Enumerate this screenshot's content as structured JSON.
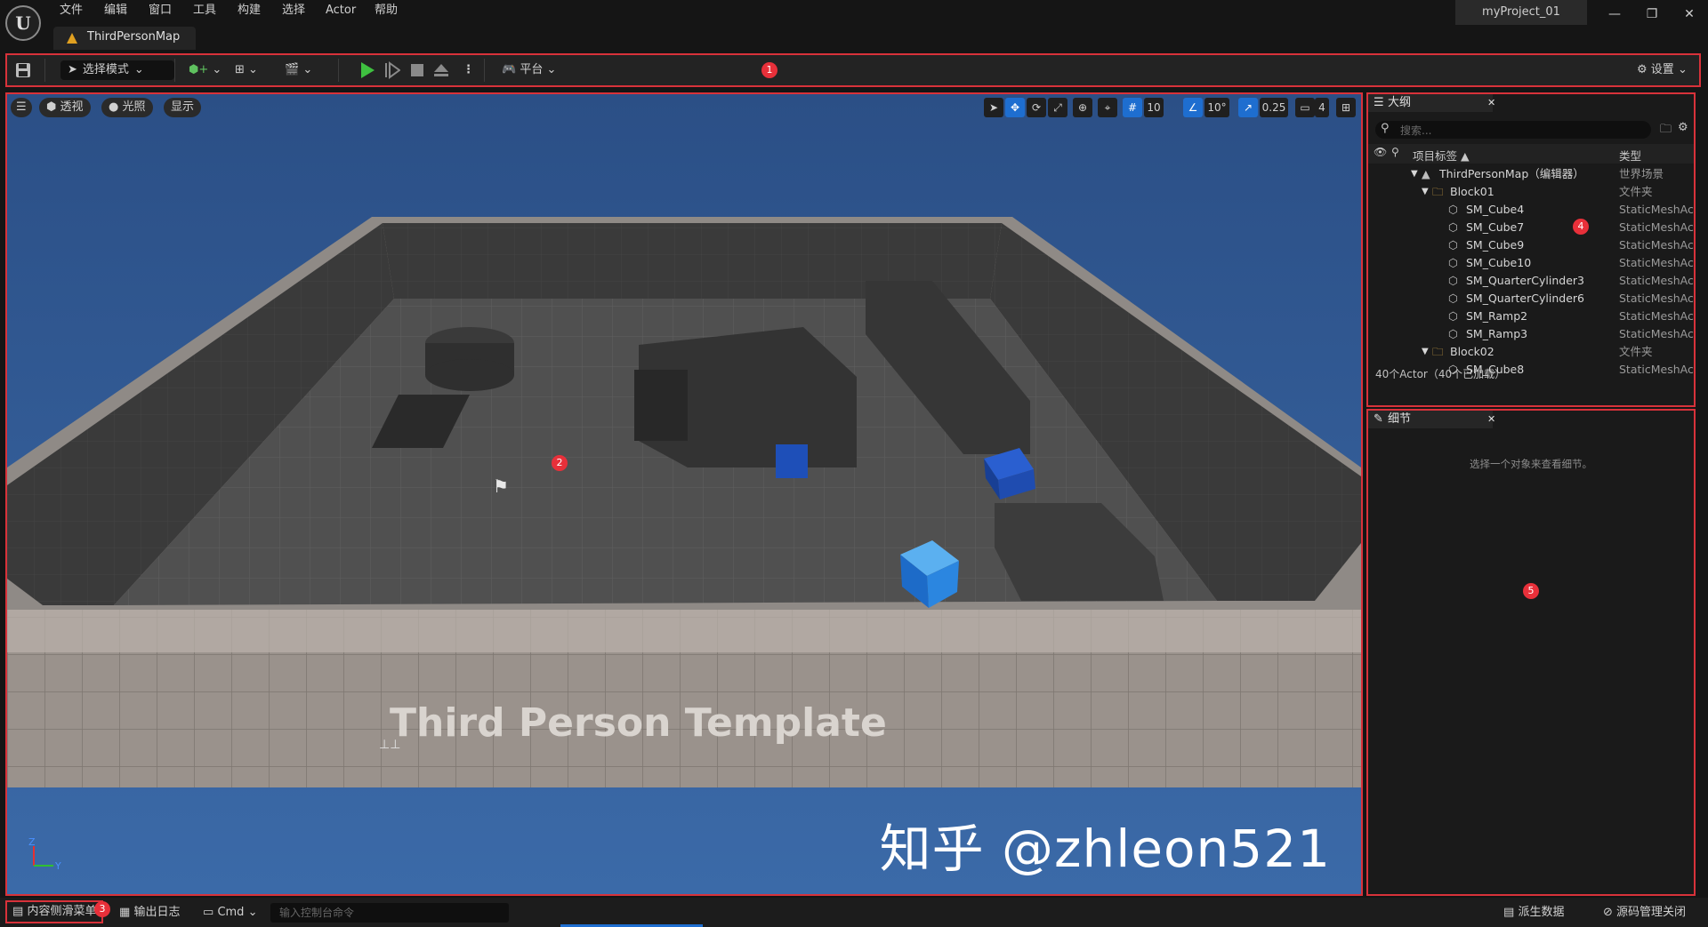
{
  "app": {
    "logo_icon": "unreal-logo-icon",
    "menu": [
      "文件",
      "编辑",
      "窗口",
      "工具",
      "构建",
      "选择",
      "Actor",
      "帮助"
    ],
    "project_name": "myProject_01",
    "map_tab": "ThirdPersonMap",
    "window_controls": {
      "minimize": "—",
      "restore": "❐",
      "close": "✕"
    }
  },
  "toolbar": {
    "select_mode": "选择模式",
    "platform": "平台",
    "settings": "设置",
    "badge": "1"
  },
  "viewport": {
    "perspective": "透视",
    "lit": "光照",
    "show": "显示",
    "grid_snap": "10",
    "rotation_snap": "10°",
    "scale_snap": "0.25",
    "camera_speed": "4",
    "badge": "2",
    "floor_text": "Third Person Template",
    "watermark": "知乎 @zhleon521",
    "axis_z": "Z",
    "axis_y": "Y"
  },
  "outliner": {
    "tab": "大纲",
    "search_placeholder": "搜索...",
    "col_label": "项目标签 ▲",
    "col_type": "类型",
    "rows": [
      {
        "name": "ThirdPersonMap（编辑器）",
        "type": "世界场景",
        "icon": "map-icon"
      },
      {
        "name": "Block01",
        "type": "文件夹",
        "icon": "folder-icon"
      },
      {
        "name": "SM_Cube4",
        "type": "StaticMeshAct",
        "icon": "mesh-icon"
      },
      {
        "name": "SM_Cube7",
        "type": "StaticMeshAct",
        "icon": "mesh-icon"
      },
      {
        "name": "SM_Cube9",
        "type": "StaticMeshAct",
        "icon": "mesh-icon"
      },
      {
        "name": "SM_Cube10",
        "type": "StaticMeshAct",
        "icon": "mesh-icon"
      },
      {
        "name": "SM_QuarterCylinder3",
        "type": "StaticMeshAct",
        "icon": "mesh-icon"
      },
      {
        "name": "SM_QuarterCylinder6",
        "type": "StaticMeshAct",
        "icon": "mesh-icon"
      },
      {
        "name": "SM_Ramp2",
        "type": "StaticMeshAct",
        "icon": "mesh-icon"
      },
      {
        "name": "SM_Ramp3",
        "type": "StaticMeshAct",
        "icon": "mesh-icon"
      },
      {
        "name": "Block02",
        "type": "文件夹",
        "icon": "folder-icon"
      },
      {
        "name": "SM_Cube8",
        "type": "StaticMeshAct",
        "icon": "mesh-icon"
      }
    ],
    "footer": "40个Actor（40个已加载）",
    "badge": "4"
  },
  "details": {
    "tab": "细节",
    "empty_text": "选择一个对象来查看细节。",
    "badge": "5"
  },
  "bottom": {
    "content_drawer": "内容侧滑菜单",
    "output_log": "输出日志",
    "cmd": "Cmd",
    "console_placeholder": "输入控制台命令",
    "derived_data": "派生数据",
    "source_control": "源码管理关闭",
    "badge": "3"
  },
  "colors": {
    "highlight_border": "#d8323a",
    "badge": "#e8303a",
    "play": "#3fc040",
    "accent_blue": "#1e6ed0"
  }
}
